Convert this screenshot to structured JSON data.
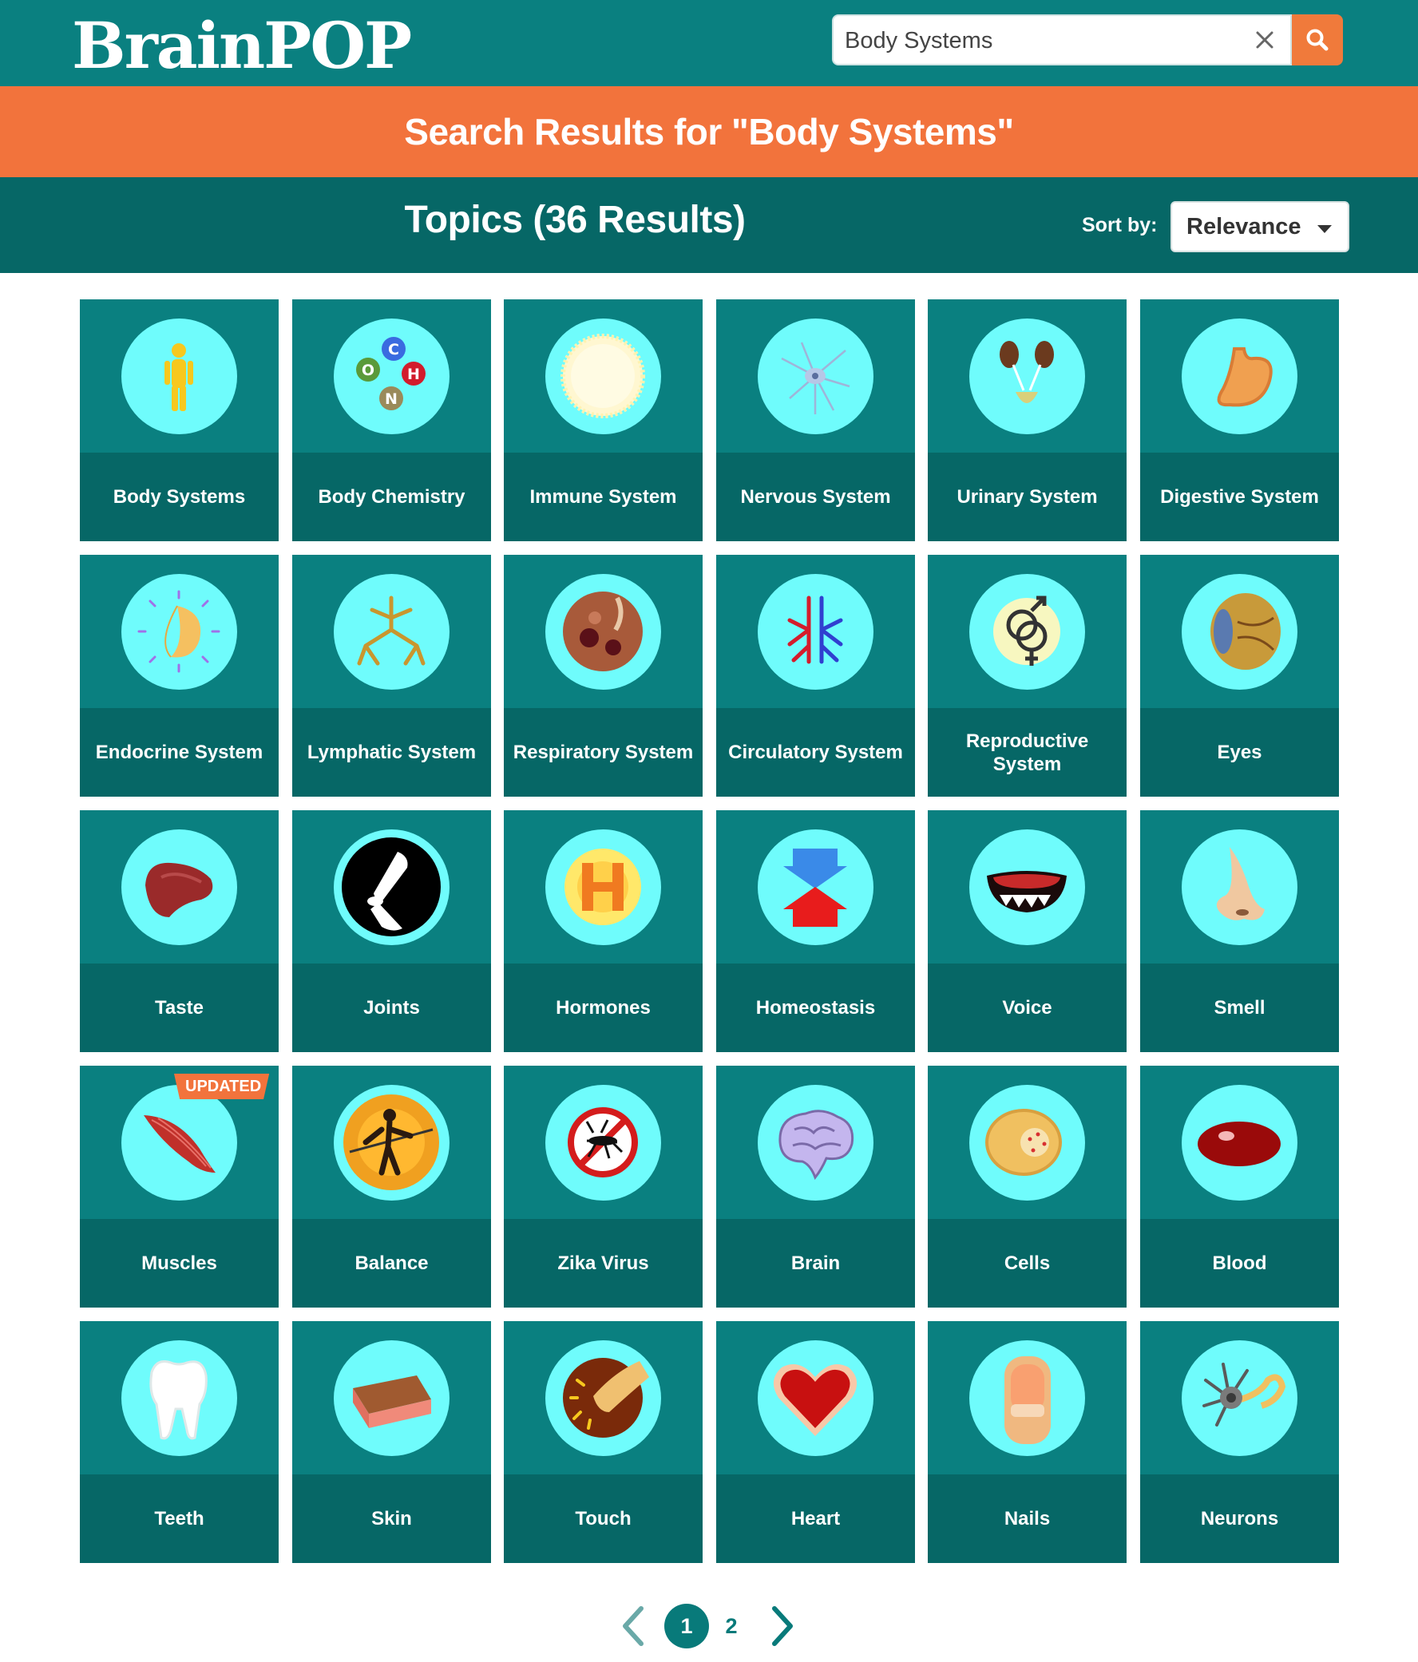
{
  "header": {
    "logo": "BrainPOP",
    "search_value": "Body Systems",
    "search_placeholder": "Search",
    "clear_icon": "close-icon",
    "search_icon": "magnifier-icon"
  },
  "banner": {
    "title": "Search Results for \"Body Systems\""
  },
  "topics_bar": {
    "title": "Topics (36 Results)",
    "sort_label": "Sort by:",
    "sort_value": "Relevance"
  },
  "colors": {
    "header_teal": "#0a8080",
    "banner_orange": "#f2733c",
    "dark_teal": "#066766",
    "circle_cyan": "#6ffcfc"
  },
  "tiles": [
    {
      "label": "Body Systems",
      "icon": "person-icon"
    },
    {
      "label": "Body Chemistry",
      "icon": "molecule-icon"
    },
    {
      "label": "Immune System",
      "icon": "white-blood-cell-icon"
    },
    {
      "label": "Nervous System",
      "icon": "neuron-cell-icon"
    },
    {
      "label": "Urinary System",
      "icon": "kidneys-icon"
    },
    {
      "label": "Digestive System",
      "icon": "stomach-icon"
    },
    {
      "label": "Endocrine System",
      "icon": "gland-icon"
    },
    {
      "label": "Lymphatic System",
      "icon": "lymph-vessels-icon"
    },
    {
      "label": "Respiratory System",
      "icon": "alveoli-icon"
    },
    {
      "label": "Circulatory System",
      "icon": "blood-vessels-icon"
    },
    {
      "label": "Reproductive System",
      "icon": "gender-symbols-icon"
    },
    {
      "label": "Eyes",
      "icon": "eyeball-icon"
    },
    {
      "label": "Taste",
      "icon": "tongue-icon"
    },
    {
      "label": "Joints",
      "icon": "joint-bones-icon"
    },
    {
      "label": "Hormones",
      "icon": "hormone-h-icon"
    },
    {
      "label": "Homeostasis",
      "icon": "arrows-balance-icon"
    },
    {
      "label": "Voice",
      "icon": "mouth-icon"
    },
    {
      "label": "Smell",
      "icon": "nose-icon"
    },
    {
      "label": "Muscles",
      "icon": "muscle-icon",
      "badge": "UPDATED"
    },
    {
      "label": "Balance",
      "icon": "tightrope-walker-icon"
    },
    {
      "label": "Zika Virus",
      "icon": "no-mosquito-icon"
    },
    {
      "label": "Brain",
      "icon": "brain-icon"
    },
    {
      "label": "Cells",
      "icon": "cell-icon"
    },
    {
      "label": "Blood",
      "icon": "red-blood-cell-icon"
    },
    {
      "label": "Teeth",
      "icon": "tooth-icon"
    },
    {
      "label": "Skin",
      "icon": "skin-layer-icon"
    },
    {
      "label": "Touch",
      "icon": "fingertip-icon"
    },
    {
      "label": "Heart",
      "icon": "heart-icon"
    },
    {
      "label": "Nails",
      "icon": "fingernail-icon"
    },
    {
      "label": "Neurons",
      "icon": "neuron-icon"
    }
  ],
  "pagination": {
    "pages": [
      "1",
      "2"
    ],
    "current": "1",
    "prev_icon": "chevron-left-icon",
    "next_icon": "chevron-right-icon"
  }
}
